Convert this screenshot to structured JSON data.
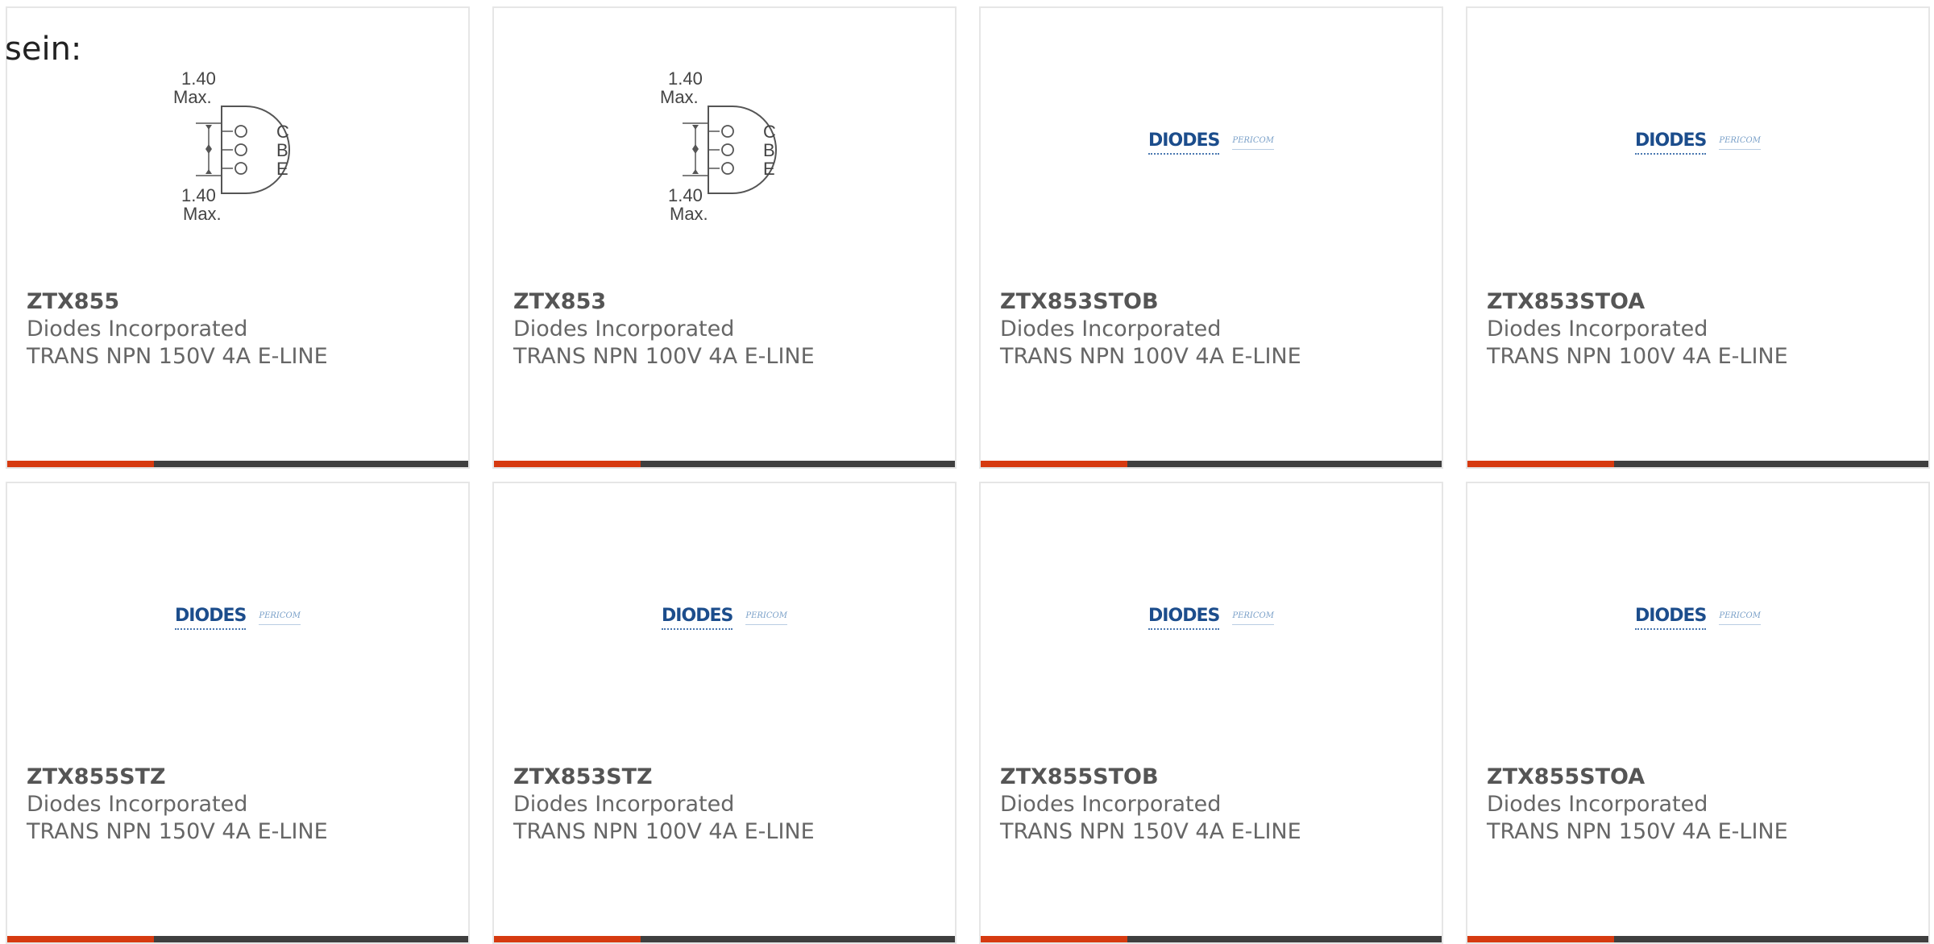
{
  "page_label": "sein:",
  "colors": {
    "accent": "#d63a10",
    "bar": "#3f3f3f",
    "border": "#e6e6e6",
    "logo_blue": "#1c4d8c"
  },
  "diagram": {
    "top_dim": "1.40",
    "top_max": "Max.",
    "bottom_dim": "1.40",
    "bottom_max": "Max.",
    "pin_c": "C",
    "pin_b": "B",
    "pin_e": "E"
  },
  "logo": {
    "main": "DIODES",
    "sub": "PERICOM"
  },
  "cards": [
    {
      "part": "ZTX855",
      "maker": "Diodes Incorporated",
      "desc": "TRANS NPN 150V 4A E-LINE",
      "image": "package-diagram"
    },
    {
      "part": "ZTX853",
      "maker": "Diodes Incorporated",
      "desc": "TRANS NPN 100V 4A E-LINE",
      "image": "package-diagram"
    },
    {
      "part": "ZTX853STOB",
      "maker": "Diodes Incorporated",
      "desc": "TRANS NPN 100V 4A E-LINE",
      "image": "diodes-logo"
    },
    {
      "part": "ZTX853STOA",
      "maker": "Diodes Incorporated",
      "desc": "TRANS NPN 100V 4A E-LINE",
      "image": "diodes-logo"
    },
    {
      "part": "ZTX855STZ",
      "maker": "Diodes Incorporated",
      "desc": "TRANS NPN 150V 4A E-LINE",
      "image": "diodes-logo"
    },
    {
      "part": "ZTX853STZ",
      "maker": "Diodes Incorporated",
      "desc": "TRANS NPN 100V 4A E-LINE",
      "image": "diodes-logo"
    },
    {
      "part": "ZTX855STOB",
      "maker": "Diodes Incorporated",
      "desc": "TRANS NPN 150V 4A E-LINE",
      "image": "diodes-logo"
    },
    {
      "part": "ZTX855STOA",
      "maker": "Diodes Incorporated",
      "desc": "TRANS NPN 150V 4A E-LINE",
      "image": "diodes-logo"
    }
  ]
}
